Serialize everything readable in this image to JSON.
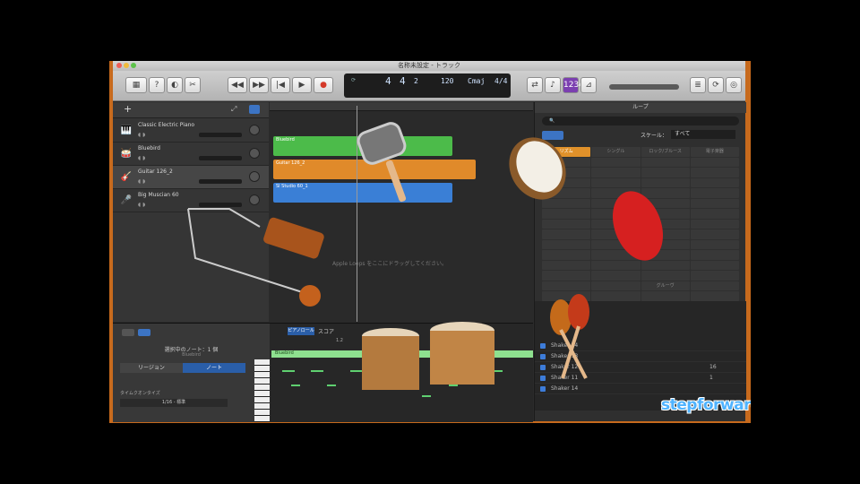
{
  "window": {
    "title": "名称未設定 - トラック"
  },
  "toolbar": {
    "lcd": {
      "bar": "4",
      "beat": "4",
      "subdivision": "2",
      "tempo": "120",
      "key": "Cmaj",
      "signature": "4/4"
    }
  },
  "tracks": [
    {
      "name": "Classic Electric Piano",
      "icon": "piano-icon"
    },
    {
      "name": "Bluebird",
      "icon": "drums-icon"
    },
    {
      "name": "Guitar 126_2",
      "icon": "guitar-icon"
    },
    {
      "name": "Big Muscian 60",
      "icon": "mic-icon"
    }
  ],
  "regions": [
    {
      "label": "Bluebird",
      "color": "#4cbb4a"
    },
    {
      "label": "Guitar 126_2",
      "color": "#e08a2a"
    },
    {
      "label": "Sl Studio 60_1",
      "color": "#3a7fd6"
    }
  ],
  "arrange": {
    "hint": "Apple Loops をここにドラッグしてください。"
  },
  "loops": {
    "title": "ループ",
    "search_placeholder": "",
    "scale_label": "スケール：",
    "scale_value": "すべて",
    "keywords": [
      "リズム",
      "シングル",
      "ロック/ブルース",
      "電子楽器",
      "",
      "",
      "",
      "",
      "",
      "",
      "",
      "",
      "",
      "",
      "",
      "",
      "",
      "",
      "",
      "",
      "",
      "",
      "",
      "",
      "",
      "",
      "",
      "",
      "",
      "",
      "",
      "",
      "",
      "",
      "",
      "",
      "",
      "",
      "",
      "",
      "",
      "",
      "",
      "",
      "",
      "",
      "",
      "",
      "",
      "",
      "",
      "",
      "",
      "",
      "グルーヴ",
      "",
      "",
      "",
      "",
      "",
      "",
      "",
      "",
      ""
    ],
    "list": [
      {
        "name": "Shaker 14",
        "num": ""
      },
      {
        "name": "Shaker 13",
        "num": ""
      },
      {
        "name": "Shaker 12",
        "num": "16"
      },
      {
        "name": "Shaker 11",
        "num": "1"
      },
      {
        "name": "Shaker 14",
        "num": ""
      }
    ],
    "visible_rows": [
      "Shaker 11",
      "Shaker 14"
    ]
  },
  "editor": {
    "tab_piano_roll": "ピアノロール",
    "tab_score": "スコア",
    "selection_label": "選択中のノート：1 個",
    "region_name": "Bluebird",
    "btn_region": "リージョン",
    "btn_note": "ノート",
    "time_quantize": "タイムクオンタイズ",
    "quantize_value": "1/16 - 標準",
    "ruler_mark": "1.2"
  },
  "brand": {
    "text": "stepforwards"
  }
}
